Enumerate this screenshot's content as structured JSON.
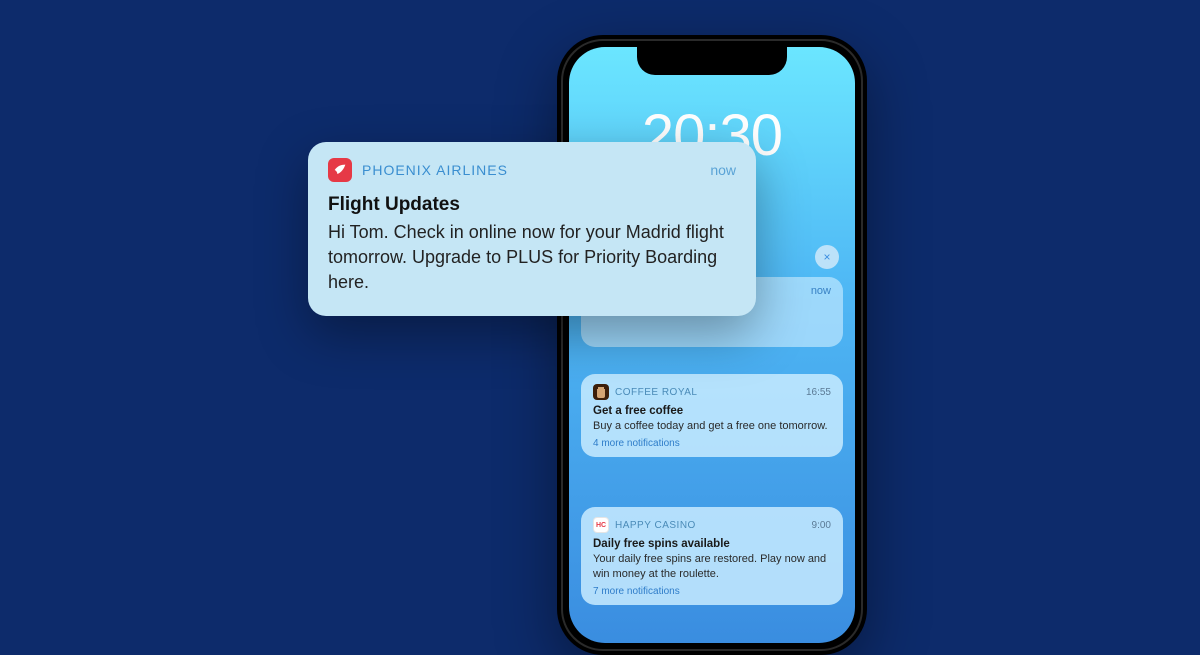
{
  "lockscreen": {
    "time": "20:30"
  },
  "popup": {
    "app": "PHOENIX AIRLINES",
    "time": "now",
    "title": "Flight Updates",
    "body": "Hi Tom. Check in online now for your Madrid flight tomorrow. Upgrade to PLUS for Priority Boarding here."
  },
  "behind_popup": {
    "time": "now"
  },
  "notifications": [
    {
      "app": "COFFEE ROYAL",
      "time": "16:55",
      "title": "Get a free coffee",
      "body": "Buy a coffee today and get a free one tomorrow.",
      "more": "4 more notifications",
      "icon_text": ""
    },
    {
      "app": "HAPPY CASINO",
      "time": "9:00",
      "title": "Daily free spins available",
      "body": "Your daily free spins are restored. Play now and win money at the roulette.",
      "more": "7 more notifications",
      "icon_text": "HC"
    }
  ],
  "close_label": "×"
}
